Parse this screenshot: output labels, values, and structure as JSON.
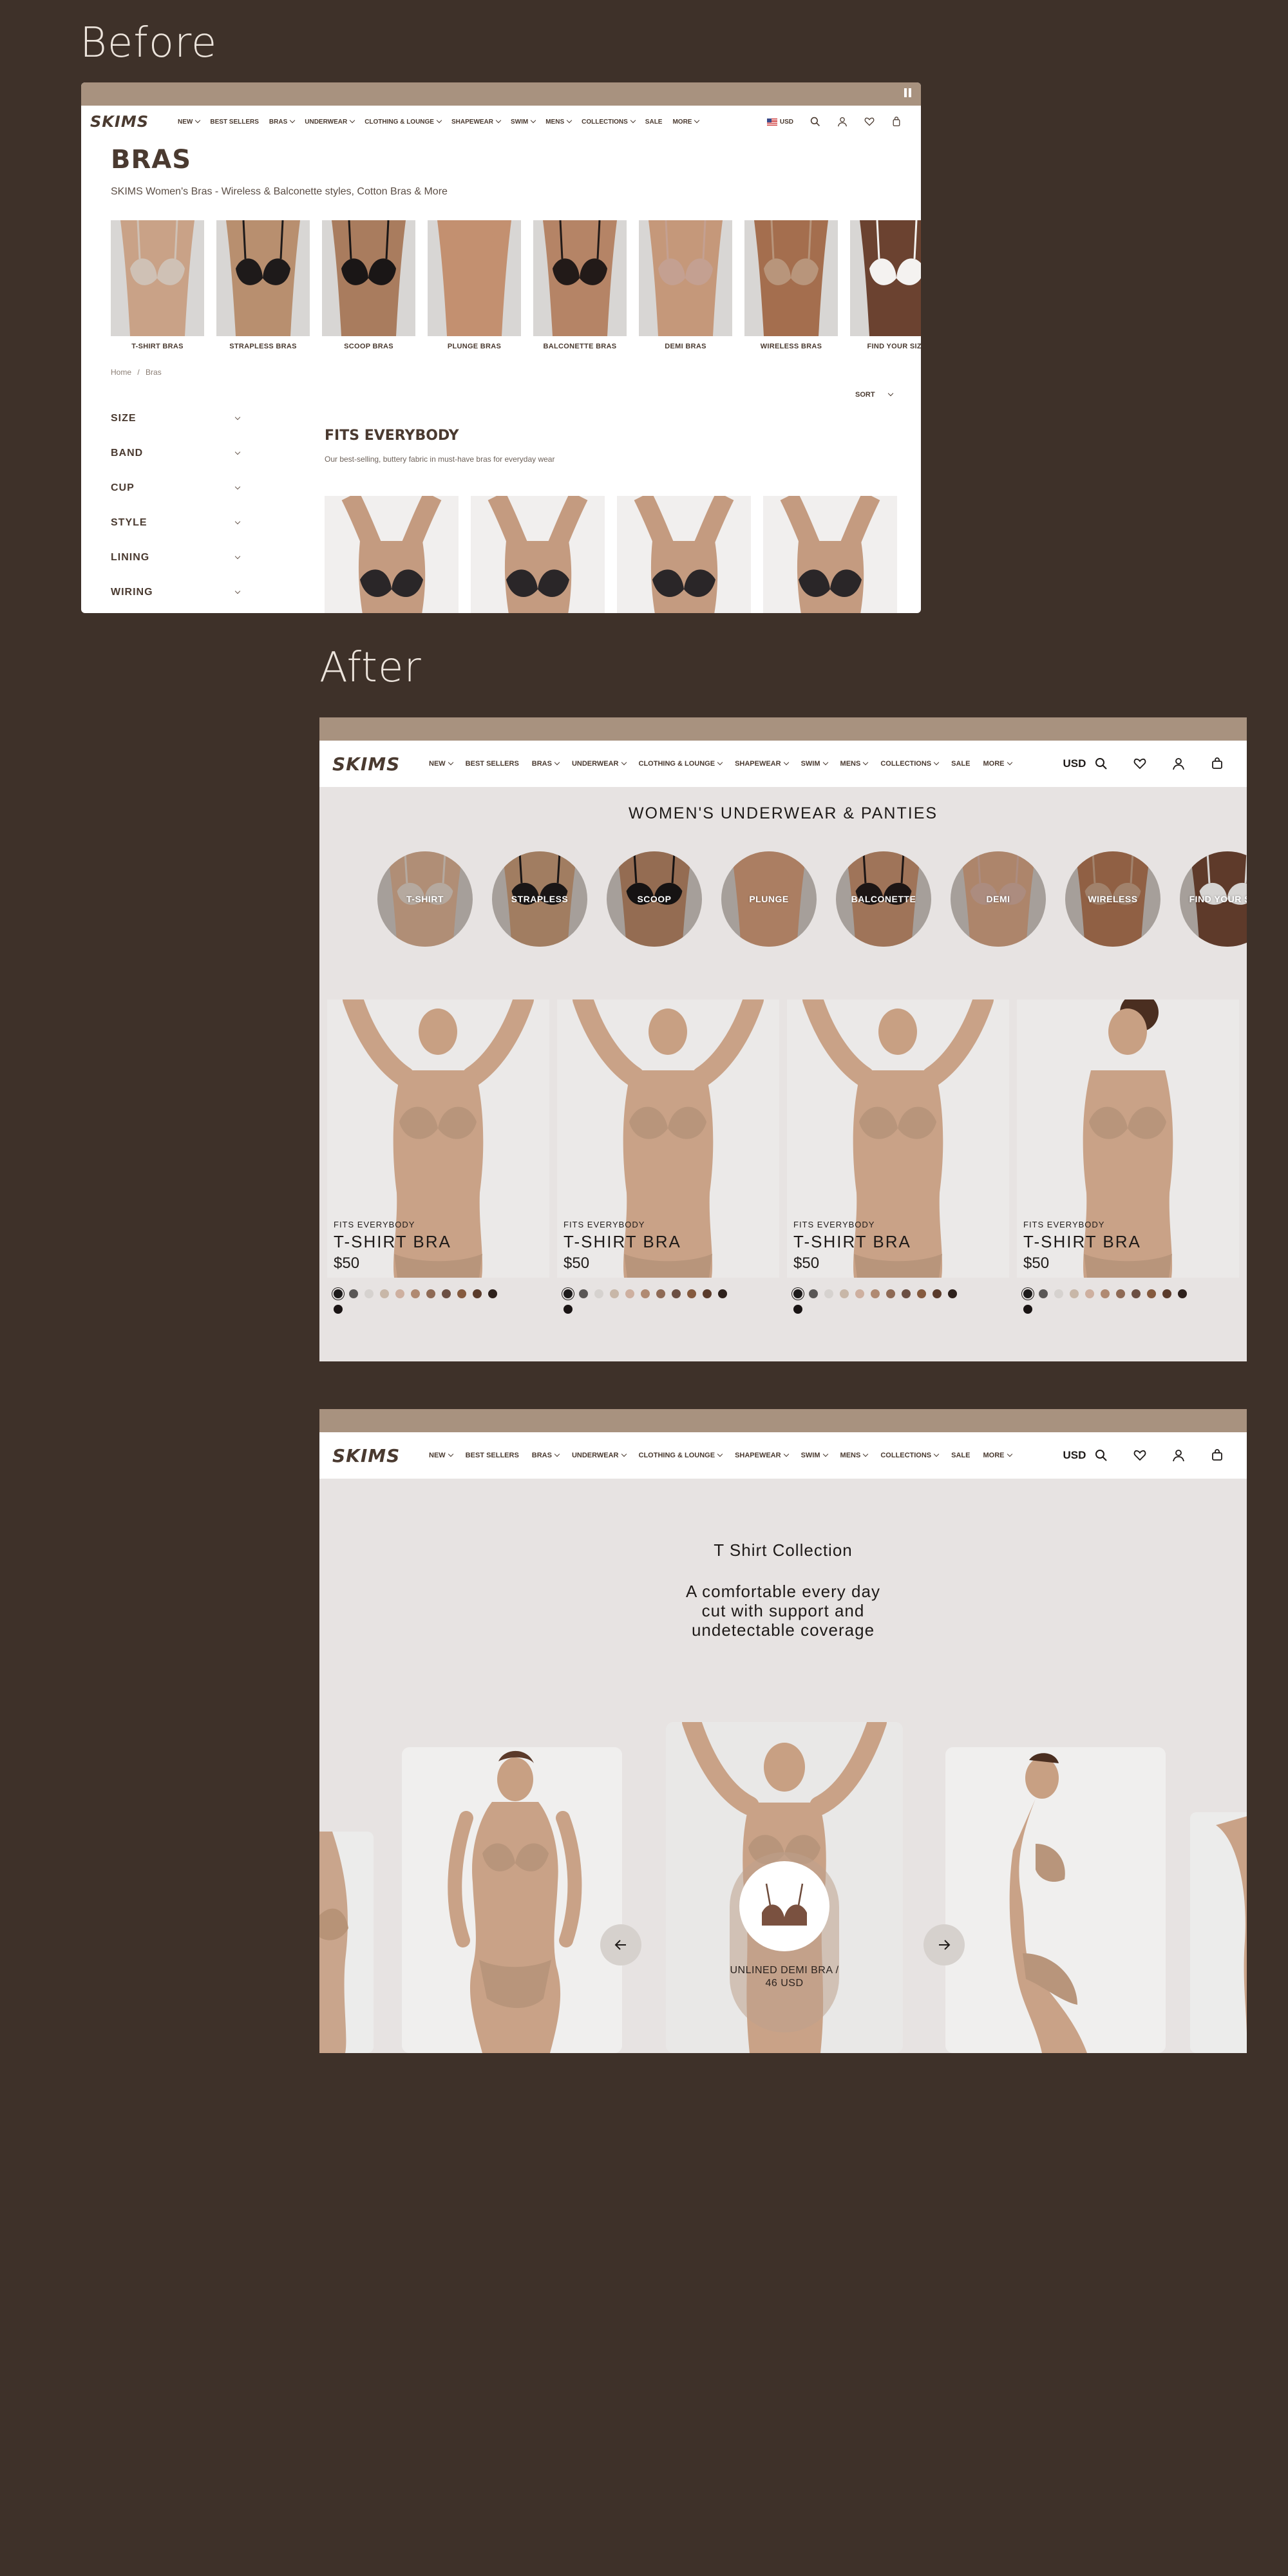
{
  "sections": {
    "before": "Before",
    "after": "After"
  },
  "nav": {
    "logo": "SKIMS",
    "items": [
      "NEW",
      "BEST SELLERS",
      "BRAS",
      "UNDERWEAR",
      "CLOTHING & LOUNGE",
      "SHAPEWEAR",
      "SWIM",
      "MENS",
      "COLLECTIONS",
      "SALE",
      "MORE"
    ],
    "items_with_chevron": [
      true,
      false,
      true,
      true,
      true,
      true,
      true,
      true,
      true,
      false,
      true
    ],
    "currency": "USD",
    "icons": [
      "search-icon",
      "heart-icon",
      "user-icon",
      "bag-icon"
    ]
  },
  "before_page": {
    "title": "BRAS",
    "subtitle": "SKIMS Women's Bras - Wireless & Balconette styles, Cotton Bras & More",
    "categories": [
      "T-SHIRT BRAS",
      "STRAPLESS BRAS",
      "SCOOP BRAS",
      "PLUNGE BRAS",
      "BALCONETTE BRAS",
      "DEMI BRAS",
      "WIRELESS BRAS",
      "FIND YOUR SIZE"
    ],
    "breadcrumb": {
      "home": "Home",
      "sep": "/",
      "current": "Bras"
    },
    "filters": [
      "SIZE",
      "BAND",
      "CUP",
      "STYLE",
      "LINING",
      "WIRING"
    ],
    "sort_label": "SORT",
    "collection_title": "FITS EVERYBODY",
    "collection_desc": "Our best-selling, buttery fabric in must-have bras for everyday wear",
    "pause_icon": "pause-icon"
  },
  "after_one": {
    "title": "WOMEN'S UNDERWEAR & PANTIES",
    "circles": [
      "T-SHIRT",
      "STRAPLESS",
      "SCOOP",
      "PLUNGE",
      "BALCONETTE",
      "DEMI",
      "WIRELESS",
      "FIND YOUR SIZE"
    ],
    "products": [
      {
        "collection": "FITS EVERYBODY",
        "name": "T-SHIRT BRA",
        "price": "$50"
      },
      {
        "collection": "FITS EVERYBODY",
        "name": "T-SHIRT BRA",
        "price": "$50"
      },
      {
        "collection": "FITS EVERYBODY",
        "name": "T-SHIRT BRA",
        "price": "$50"
      },
      {
        "collection": "FITS EVERYBODY",
        "name": "T-SHIRT BRA",
        "price": "$50"
      }
    ],
    "swatch_colors": [
      "#1d1a1a",
      "#5a5756",
      "#d6d2cf",
      "#c8b7a8",
      "#ceb0a0",
      "#b08a72",
      "#8e6a55",
      "#6c5044",
      "#855a3e",
      "#5a3b2b",
      "#2e211c",
      "#1a1414"
    ]
  },
  "after_two": {
    "heading": "T Shirt Collection",
    "tagline": "A comfortable every day cut with support and undetectable coverage",
    "product_pill": "UNLINED DEMI BRA / 46 USD",
    "prev_icon": "arrow-left-icon",
    "next_icon": "arrow-right-icon"
  },
  "colors": {
    "background": "#3e3129",
    "topbar": "#a8927f",
    "brand_text": "#4a3a30",
    "panel": "#e7e3e2"
  }
}
